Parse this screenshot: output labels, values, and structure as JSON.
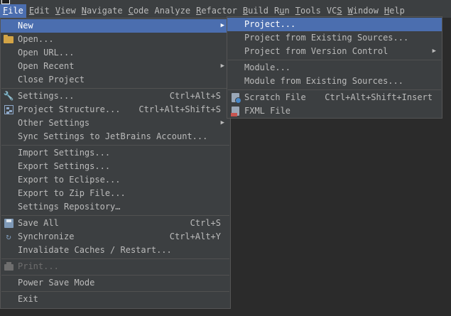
{
  "menubar": {
    "items": [
      {
        "label": "File",
        "mnemonic": "F",
        "rest": "ile",
        "active": true
      },
      {
        "label": "Edit",
        "mnemonic": "E",
        "rest": "dit"
      },
      {
        "label": "View",
        "mnemonic": "V",
        "rest": "iew"
      },
      {
        "label": "Navigate",
        "mnemonic": "N",
        "rest": "avigate"
      },
      {
        "label": "Code",
        "mnemonic": "C",
        "rest": "ode"
      },
      {
        "label": "Analyze",
        "mnemonic": "",
        "rest": "Analyze"
      },
      {
        "label": "Refactor",
        "mnemonic": "R",
        "rest": "efactor"
      },
      {
        "label": "Build",
        "mnemonic": "B",
        "rest": "uild"
      },
      {
        "label": "Run",
        "mnemonic": "",
        "rest": "Run"
      },
      {
        "label": "Tools",
        "mnemonic": "T",
        "rest": "ools"
      },
      {
        "label": "VCS",
        "mnemonic": "",
        "rest": "VCS"
      },
      {
        "label": "Window",
        "mnemonic": "W",
        "rest": "indow"
      },
      {
        "label": "Help",
        "mnemonic": "H",
        "rest": "elp"
      }
    ]
  },
  "file_menu": {
    "new": "New",
    "open": "Open...",
    "open_url": "Open URL...",
    "open_recent": "Open Recent",
    "close_project": "Close Project",
    "settings": "Settings...",
    "settings_shortcut": "Ctrl+Alt+S",
    "project_structure": "Project Structure...",
    "project_structure_shortcut": "Ctrl+Alt+Shift+S",
    "other_settings": "Other Settings",
    "sync_settings": "Sync Settings to JetBrains Account...",
    "import_settings": "Import Settings...",
    "export_settings": "Export Settings...",
    "export_eclipse": "Export to Eclipse...",
    "export_zip": "Export to Zip File...",
    "settings_repository": "Settings Repository…",
    "save_all": "Save All",
    "save_all_shortcut": "Ctrl+S",
    "synchronize": "Synchronize",
    "synchronize_shortcut": "Ctrl+Alt+Y",
    "invalidate_caches": "Invalidate Caches / Restart...",
    "print": "Print...",
    "power_save": "Power Save Mode",
    "exit": "Exit"
  },
  "new_menu": {
    "project": "Project...",
    "project_existing": "Project from Existing Sources...",
    "project_vcs": "Project from Version Control",
    "module": "Module...",
    "module_existing": "Module from Existing Sources...",
    "scratch_file": "Scratch File",
    "scratch_file_shortcut": "Ctrl+Alt+Shift+Insert",
    "fxml_file": "FXML File"
  },
  "colors": {
    "menu_bg": "#3c3f41",
    "highlight": "#4b6eaf",
    "text": "#bbbbbb",
    "disabled": "#6e6e6e"
  }
}
